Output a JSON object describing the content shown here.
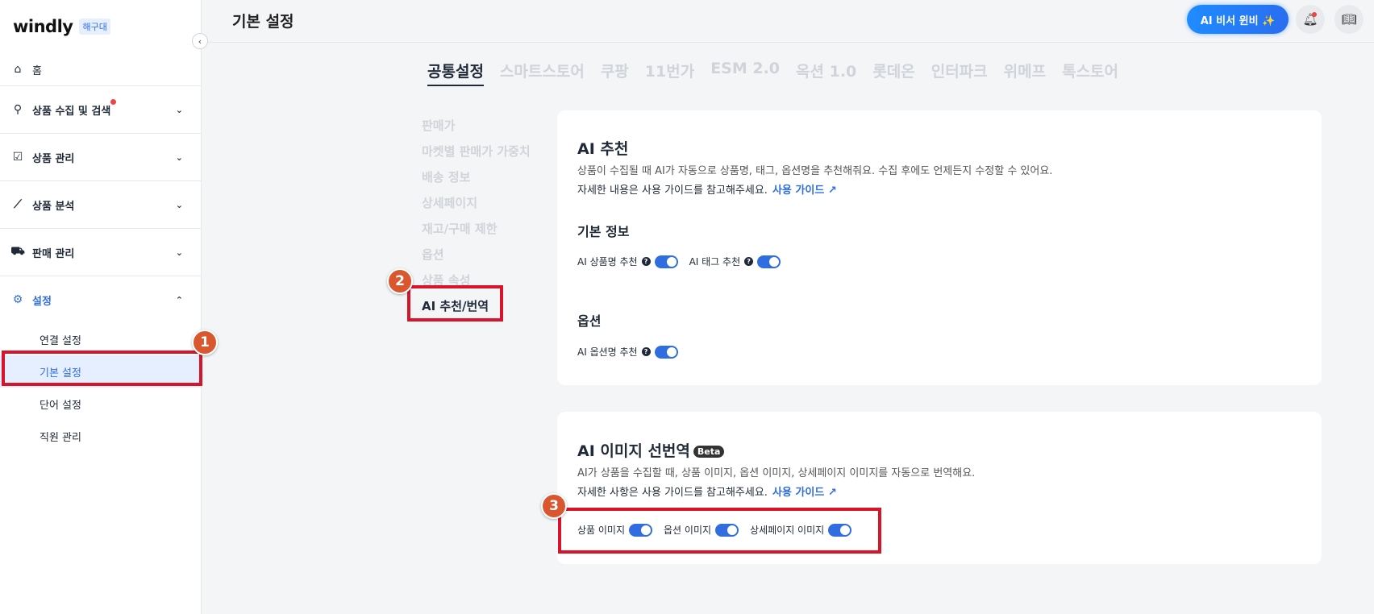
{
  "app": {
    "logo": "windly",
    "logo_badge": "해구대"
  },
  "sidebar": {
    "home": "홈",
    "groups": [
      {
        "label": "상품 수집 및 검색",
        "icon": "search-icon",
        "has_dot": true
      },
      {
        "label": "상품 관리",
        "icon": "clipboard-check-icon"
      },
      {
        "label": "상품 분석",
        "icon": "chart-line-icon"
      },
      {
        "label": "판매 관리",
        "icon": "cart-icon"
      },
      {
        "label": "설정",
        "icon": "gear-icon",
        "expanded": true
      }
    ],
    "settings_items": [
      "연결 설정",
      "기본 설정",
      "단어 설정",
      "직원 관리"
    ],
    "active_item": "기본 설정"
  },
  "header": {
    "title": "기본 설정",
    "ai_button": "AI 비서 윈비 ✨"
  },
  "tabs": [
    "공통설정",
    "스마트스토어",
    "쿠팡",
    "11번가",
    "ESM 2.0",
    "옥션 1.0",
    "롯데온",
    "인터파크",
    "위메프",
    "톡스토어"
  ],
  "active_tab": "공통설정",
  "subnav": [
    "판매가",
    "마켓별 판매가 가중치",
    "배송 정보",
    "상세페이지",
    "재고/구매 제한",
    "옵션",
    "상품 속성",
    "AI 추천/번역"
  ],
  "active_subnav": "AI 추천/번역",
  "ai_recommend": {
    "title": "AI 추천",
    "desc": "상품이 수집될 때 AI가 자동으로 상품명, 태그, 옵션명을 추천해줘요. 수집 후에도 언제든지 수정할 수 있어요.",
    "guide_text": "자세한 내용은 사용 가이드를 참고해주세요.",
    "guide_link": "사용 가이드",
    "basic_info_title": "기본 정보",
    "product_name_toggle": "AI 상품명 추천",
    "tag_toggle": "AI 태그 추천",
    "option_title": "옵션",
    "option_name_toggle": "AI 옵션명 추천"
  },
  "ai_image": {
    "title": "AI 이미지 선번역",
    "badge": "Beta",
    "desc": "AI가 상품을 수집할 때, 상품 이미지, 옵션 이미지, 상세페이지 이미지를 자동으로 번역해요.",
    "guide_text": "자세한 사항은 사용 가이드를 참고해주세요.",
    "guide_link": "사용 가이드",
    "toggles": [
      "상품 이미지",
      "옵션 이미지",
      "상세페이지 이미지"
    ]
  },
  "markers": [
    "1",
    "2",
    "3"
  ]
}
